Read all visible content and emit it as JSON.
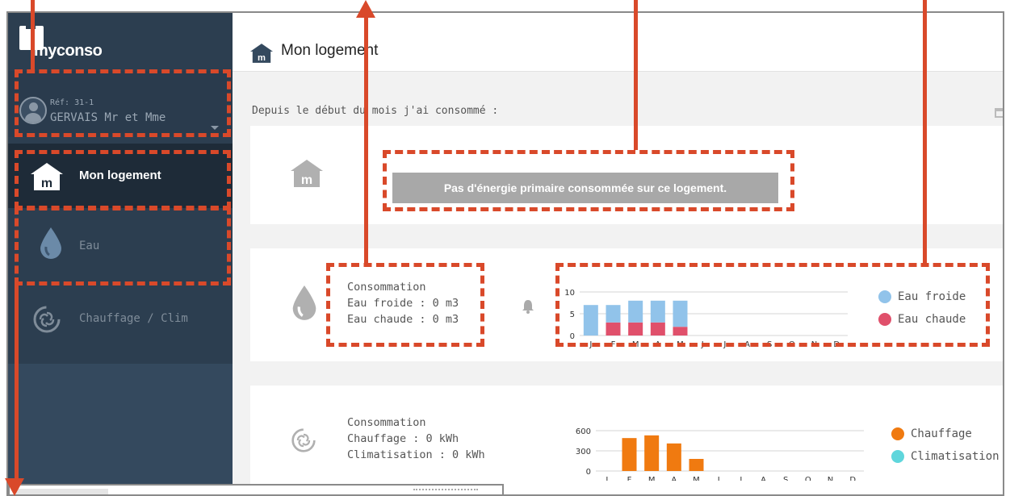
{
  "app": {
    "logo_text": "myconso"
  },
  "user": {
    "ref": "Réf: 31-1",
    "name": "GERVAIS Mr et Mme"
  },
  "sidebar": {
    "items": [
      {
        "label": "Mon logement",
        "icon": "home-icon",
        "active": true
      },
      {
        "label": "Eau",
        "icon": "water-drop-icon",
        "active": false
      },
      {
        "label": "Chauffage / Clim",
        "icon": "heating-icon",
        "active": false
      }
    ]
  },
  "header": {
    "title": "Mon logement",
    "icon": "home-icon"
  },
  "intro_text": "Depuis le début du mois j'ai consommé :",
  "energy": {
    "message": "Pas d'énergie primaire consommée sur ce logement."
  },
  "water": {
    "title": "Consommation",
    "cold": "Eau froide : 0 m3",
    "hot": "Eau chaude : 0 m3",
    "legend": [
      {
        "name": "Eau froide",
        "color": "#91c3ea"
      },
      {
        "name": "Eau chaude",
        "color": "#e0506b"
      }
    ]
  },
  "heating": {
    "title": "Consommation",
    "heat": "Chauffage : 0 kWh",
    "cool": "Climatisation : 0 kWh",
    "legend": [
      {
        "name": "Chauffage",
        "color": "#f07a10"
      },
      {
        "name": "Climatisation",
        "color": "#5fd6dc"
      }
    ]
  },
  "colors": {
    "sidebar": "#2c3e50",
    "accent": "#d9492a"
  },
  "chart_data": [
    {
      "type": "bar",
      "stacked": true,
      "categories": [
        "J",
        "F",
        "M",
        "A",
        "M",
        "J",
        "J",
        "A",
        "S",
        "O",
        "N",
        "D"
      ],
      "series": [
        {
          "name": "Eau chaude",
          "values": [
            0,
            3,
            3,
            3,
            2,
            0,
            0,
            0,
            0,
            0,
            0,
            0
          ]
        },
        {
          "name": "Eau froide",
          "values": [
            7,
            4,
            5,
            5,
            6,
            0,
            0,
            0,
            0,
            0,
            0,
            0
          ]
        }
      ],
      "yticks": [
        "0",
        "5",
        "10"
      ],
      "ylim": [
        0,
        10
      ]
    },
    {
      "type": "bar",
      "categories": [
        "J",
        "F",
        "M",
        "A",
        "M",
        "J",
        "J",
        "A",
        "S",
        "O",
        "N",
        "D"
      ],
      "series": [
        {
          "name": "Chauffage",
          "values": [
            0,
            490,
            530,
            410,
            180,
            0,
            0,
            0,
            0,
            0,
            0,
            0
          ]
        },
        {
          "name": "Climatisation",
          "values": [
            0,
            0,
            0,
            0,
            0,
            0,
            0,
            0,
            0,
            0,
            0,
            0
          ]
        }
      ],
      "yticks": [
        "0",
        "300",
        "600"
      ],
      "ylim": [
        0,
        600
      ]
    }
  ]
}
